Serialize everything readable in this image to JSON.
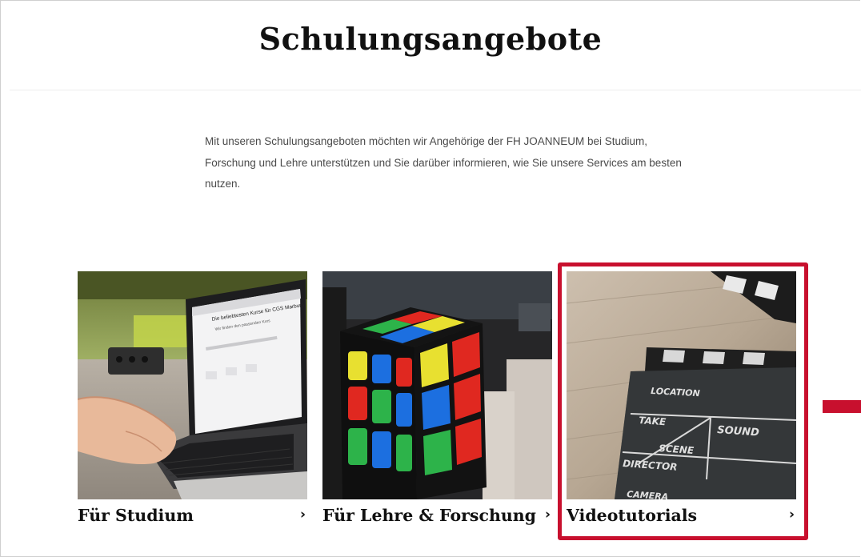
{
  "page": {
    "title": "Schulungsangebote",
    "intro_lines": [
      "Mit unseren Schulungsangeboten möchten wir Angehörige der FH JOANNEUM bei Studium,",
      "Forschung und Lehre unterstützen und Sie darüber informieren, wie Sie unsere Services am besten",
      "nutzen."
    ]
  },
  "cards": [
    {
      "label": "Für Studium",
      "chevron": "›",
      "image": "laptop-typing-photo"
    },
    {
      "label": "Für Lehre & Forschung",
      "chevron": "›",
      "image": "rubiks-cube-photo"
    },
    {
      "label": "Videotutorials",
      "chevron": "›",
      "image": "film-clapperboard-photo",
      "clapper_text": [
        "LOCATION",
        "TAKE",
        "SOUND",
        "SCENE",
        "DIRECTOR",
        "CAMERA"
      ]
    }
  ],
  "laptop_screen_text": {
    "heading": "Die beliebtesten Kurse für CGS Marburg",
    "sub": "Wir finden den passenden Kurs"
  },
  "colors": {
    "accent": "#c8102e",
    "text": "#111111",
    "body_text": "#4a4a4a"
  }
}
